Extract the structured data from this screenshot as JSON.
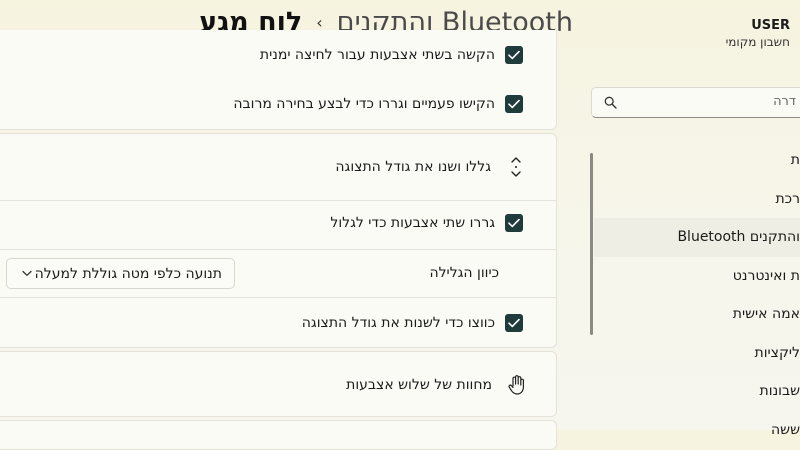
{
  "title": {
    "parent": "Bluetooth והתקנים",
    "current": "לוח מגע",
    "separator": "›"
  },
  "user": {
    "name": "USER",
    "account_type": "חשבון מקומי"
  },
  "search": {
    "placeholder": "דרה"
  },
  "sidebar": {
    "items": [
      {
        "label": "ת"
      },
      {
        "label": "רכת"
      },
      {
        "label": "Bluetooth והתקנים",
        "active": true
      },
      {
        "label": "ת ואינטרנט"
      },
      {
        "label": "אמה אישית"
      },
      {
        "label": "ליקציות"
      },
      {
        "label": "שבונות"
      },
      {
        "label": "ששה"
      }
    ]
  },
  "main": {
    "taps_section": {
      "right_click_label": "הקשה בשתי אצבעות עבור לחיצה ימנית",
      "right_click_checked": true,
      "double_tap_drag_label": "הקישו פעמיים וגררו כדי לבצע בחירה מרובה",
      "double_tap_drag_checked": true
    },
    "scroll_zoom_section": {
      "header_label": "גללו ושנו את גודל התצוגה",
      "two_finger_scroll_label": "גררו שתי אצבעות כדי לגלול",
      "two_finger_scroll_checked": true,
      "scroll_direction_label": "כיוון הגלילה",
      "scroll_direction_value": "תנועה כלפי מטה גוללת למעלה",
      "pinch_zoom_label": "כווצו כדי לשנות את גודל התצוגה",
      "pinch_zoom_checked": true
    },
    "three_finger_section": {
      "header_label": "מחוות של שלוש אצבעות"
    }
  },
  "colors": {
    "accent": "#1f3b3c",
    "background": "#f6f5ea",
    "card": "#fbfbf6"
  }
}
